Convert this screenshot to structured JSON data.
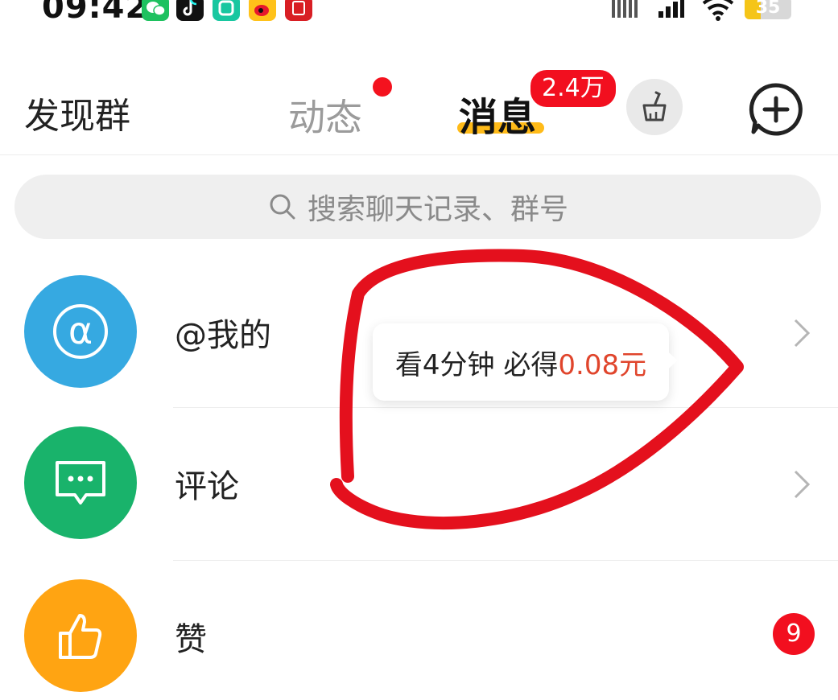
{
  "status_bar": {
    "time": "09:42",
    "battery": "35",
    "battery_level": 0.35,
    "icons": [
      "wechat-icon",
      "tiktok-icon",
      "app-green-icon",
      "weibo-icon",
      "app-red-icon",
      "signal-icon",
      "wifi-icon",
      "battery-icon"
    ]
  },
  "header": {
    "discover_label": "发现群",
    "tab_dynamic": "动态",
    "tab_messages": "消息",
    "message_badge": "2.4万",
    "accent": "#ffb400",
    "badge_color": "#f20f1f"
  },
  "search": {
    "placeholder": "搜索聊天记录、群号"
  },
  "list": [
    {
      "label": "@我的",
      "icon": "at-icon",
      "color": "#36a9e1"
    },
    {
      "label": "评论",
      "icon": "comment-icon",
      "color": "#19b36b"
    },
    {
      "label": "赞",
      "icon": "thumbs-up-icon",
      "color": "#ffa412",
      "badge": "9"
    }
  ],
  "tooltip": {
    "prefix": "看4分钟 必得",
    "amount": "0.08元"
  },
  "annotation_color": "#e4101d"
}
